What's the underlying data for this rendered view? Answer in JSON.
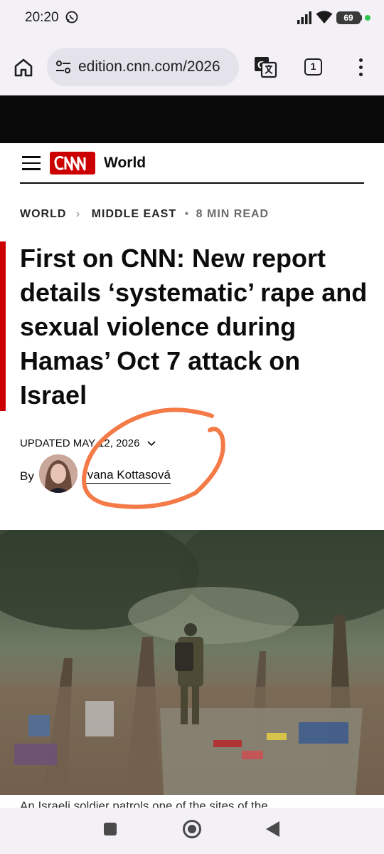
{
  "status": {
    "time": "20:20",
    "battery": "69"
  },
  "browser": {
    "url": "edition.cnn.com/2026",
    "tab_count": "1"
  },
  "header": {
    "section": "World"
  },
  "breadcrumb": {
    "level1": "WORLD",
    "level2": "MIDDLE EAST",
    "read_time": "8 MIN READ"
  },
  "article": {
    "headline": "First on CNN: New report details ‘systematic’ rape and sexual violence during Hamas’ Oct 7 attack on Israel",
    "updated": "UPDATED MAY 12, 2026",
    "by_label": "By",
    "author": "Ivana Kottasová",
    "caption": "An Israeli soldier patrols one of the sites of the"
  },
  "colors": {
    "cnn_red": "#cc0000",
    "annotation": "#f47a47"
  }
}
